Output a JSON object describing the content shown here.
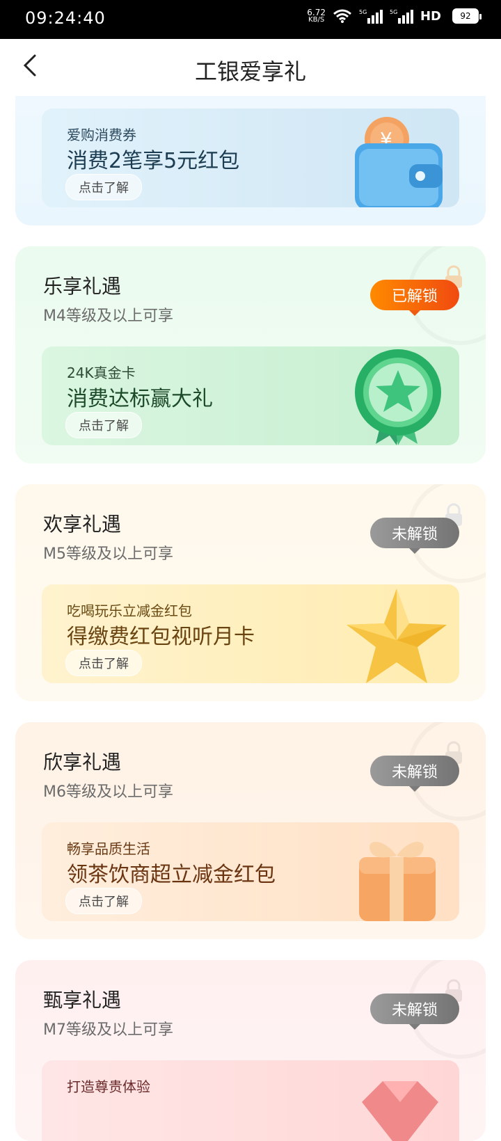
{
  "status_bar": {
    "time": "09:24:40",
    "net_speed_value": "6.72",
    "net_speed_unit": "KB/S",
    "signal1_label": "5G",
    "signal2_label": "5G",
    "hd_label": "HD",
    "battery": "92"
  },
  "header": {
    "title": "工银爱享礼"
  },
  "cards": [
    {
      "name": "",
      "level": "",
      "badge": "",
      "inner": {
        "sub": "爱购消费券",
        "main": "消费2笔享5元红包",
        "button": "点击了解"
      }
    },
    {
      "name": "乐享礼遇",
      "level": "M4等级及以上可享",
      "badge": "已解锁",
      "inner": {
        "sub": "24K真金卡",
        "main": "消费达标赢大礼",
        "button": "点击了解"
      }
    },
    {
      "name": "欢享礼遇",
      "level": "M5等级及以上可享",
      "badge": "未解锁",
      "inner": {
        "sub": "吃喝玩乐立减金红包",
        "main": "得缴费红包视听月卡",
        "button": "点击了解"
      }
    },
    {
      "name": "欣享礼遇",
      "level": "M6等级及以上可享",
      "badge": "未解锁",
      "inner": {
        "sub": "畅享品质生活",
        "main": "领茶饮商超立减金红包",
        "button": "点击了解"
      }
    },
    {
      "name": "甄享礼遇",
      "level": "M7等级及以上可享",
      "badge": "未解锁",
      "inner": {
        "sub": "打造尊贵体验"
      }
    }
  ],
  "colors": {
    "unlocked_badge": "#f05a10",
    "locked_badge": "#7c7c7c",
    "green_card": "#ebfbef",
    "yellow_card": "#fff8ec",
    "orange_card": "#fff2e6",
    "pink_card": "#fff0f0",
    "blue_card": "#eef8fe"
  },
  "icons": {
    "back": "chevron-left-icon",
    "wifi": "wifi-icon",
    "signal": "signal-5g-icon",
    "lock": "lock-icon",
    "wallet": "wallet-coin-icon",
    "medal": "star-medal-icon",
    "star": "gold-star-icon",
    "gift": "gift-box-icon",
    "gem": "diamond-icon"
  }
}
